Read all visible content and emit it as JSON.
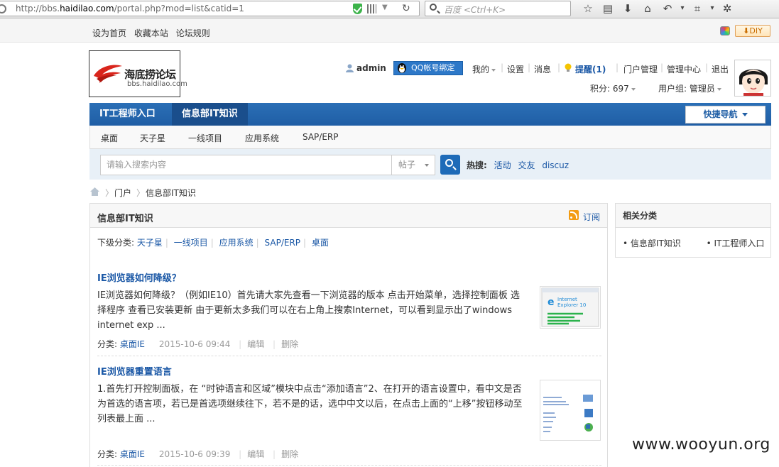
{
  "browser": {
    "url_prefix": "http://bbs.",
    "url_domain": "haidilao.com",
    "url_path": "/portal.php?mod=list&catid=1",
    "search_placeholder": "百度 <Ctrl+K>"
  },
  "topbar": {
    "links": [
      "设为首页",
      "收藏本站",
      "论坛规则"
    ],
    "diy_label": "DIY"
  },
  "logo": {
    "title": "海底捞论坛",
    "subtitle": "bbs.haidilao.com"
  },
  "user": {
    "name": "admin",
    "qq_bind": "QQ帐号绑定",
    "my": "我的",
    "settings": "设置",
    "messages": "消息",
    "remind": "提醒(1)",
    "portal_manage": "门户管理",
    "admin_center": "管理中心",
    "logout": "退出",
    "points": "积分: 697",
    "group": "用户组: 管理员"
  },
  "nav": {
    "items": [
      "IT工程师入口",
      "信息部IT知识"
    ],
    "quick_nav": "快捷导航"
  },
  "subnav": {
    "items": [
      "桌面",
      "天子星",
      "一线项目",
      "应用系统",
      "SAP/ERP"
    ]
  },
  "search": {
    "placeholder": "请输入搜索内容",
    "type": "帖子",
    "hot_label": "热搜:",
    "hot_words": [
      "活动",
      "交友",
      "discuz"
    ]
  },
  "breadcrumb": [
    "门户",
    "信息部IT知识"
  ],
  "main": {
    "title": "信息部IT知识",
    "subscribe": "订阅",
    "subcat_label": "下级分类:",
    "subcats": [
      "天子星",
      "一线项目",
      "应用系统",
      "SAP/ERP",
      "桌面"
    ],
    "articles": [
      {
        "title": "IE浏览器如何降级？",
        "summary": "IE浏览器如何降级？（例如IE10）首先请大家先查看一下浏览器的版本 点击开始菜单，选择控制面板 选择程序 查看已安装更新 由于更新太多我们可以在右上角上搜索Internet，可以看到显示出了windows internet exp ...",
        "category_label": "分类:",
        "category": "桌面IE",
        "date": "2015-10-6 09:44",
        "edit": "编辑",
        "delete": "删除",
        "thumb_text": "Internet Explorer 10"
      },
      {
        "title": "IE浏览器重置语言",
        "summary": "1.首先打开控制面板，在 “时钟语言和区域”模块中点击“添加语言”2、在打开的语言设置中，看中文是否为首选的语言项，若已是首选项继续往下，若不是的话，选中中文以后，在点击上面的“上移”按钮移动至列表最上面 ...",
        "category_label": "分类:",
        "category": "桌面IE",
        "date": "2015-10-6 09:39",
        "edit": "编辑",
        "delete": "删除"
      }
    ]
  },
  "side": {
    "title": "相关分类",
    "items": [
      "信息部IT知识",
      "IT工程师入口"
    ]
  },
  "watermark": "www.wooyun.org",
  "colors": {
    "nav_blue": "#1f5ea5",
    "link_blue": "#1b58a6",
    "qq_blue": "#2d78c8"
  }
}
